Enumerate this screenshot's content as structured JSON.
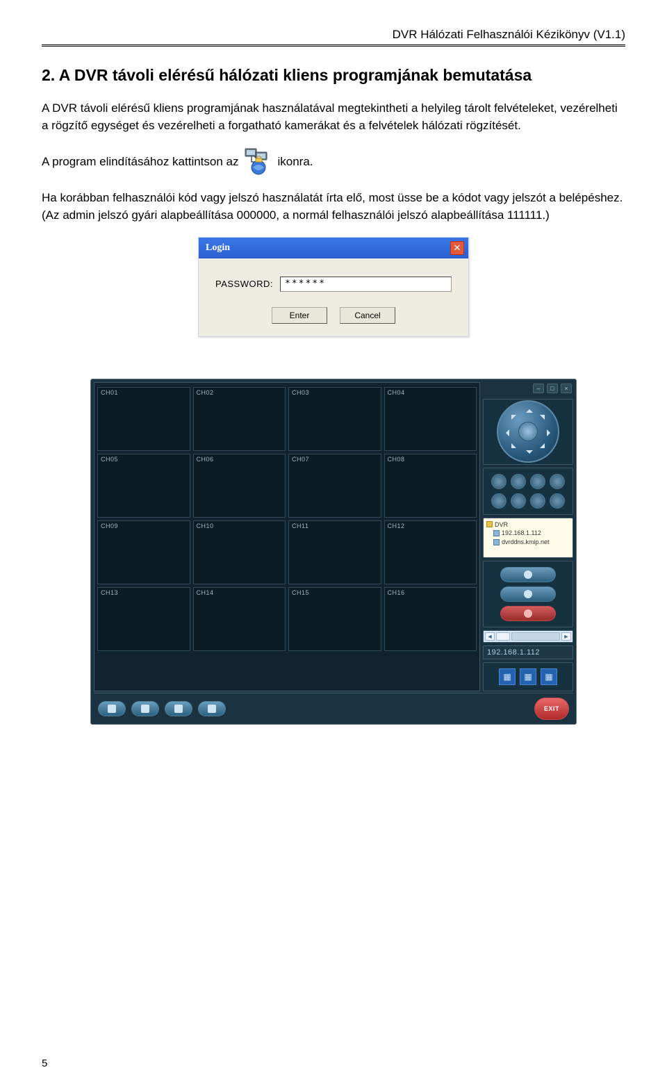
{
  "doc": {
    "header": "DVR Hálózati Felhasználói Kézikönyv (V1.1)",
    "section_title": "2. A DVR távoli elérésű hálózati kliens programjának bemutatása",
    "para1": "A DVR távoli elérésű kliens programjának használatával megtekintheti a helyileg tárolt felvételeket, vezérelheti a rögzítő egységet és vezérelheti a forgatható kamerákat és a felvételek hálózati rögzítését.",
    "para2_pre": "A program elindításához kattintson az",
    "para2_post": "ikonra.",
    "para3": "Ha korábban felhasználói kód vagy jelszó használatát írta elő, most üsse be a kódot vagy jelszót a belépéshez. (Az admin jelszó gyári alapbeállítása 000000, a normál felhasználói jelszó alapbeállítása 111111.)",
    "page_number": "5"
  },
  "login": {
    "title": "Login",
    "label": "PASSWORD:",
    "value": "******",
    "enter": "Enter",
    "cancel": "Cancel"
  },
  "dvr": {
    "channels": [
      "CH01",
      "CH02",
      "CH03",
      "CH04",
      "CH05",
      "CH06",
      "CH07",
      "CH08",
      "CH09",
      "CH10",
      "CH11",
      "CH12",
      "CH13",
      "CH14",
      "CH15",
      "CH16"
    ],
    "tree_root": "DVR",
    "tree_ip": "192.168.1.112",
    "tree_ddns": "dvrddns.kmip.net",
    "ip_display": "192.168.1.112",
    "exit": "EXIT"
  }
}
